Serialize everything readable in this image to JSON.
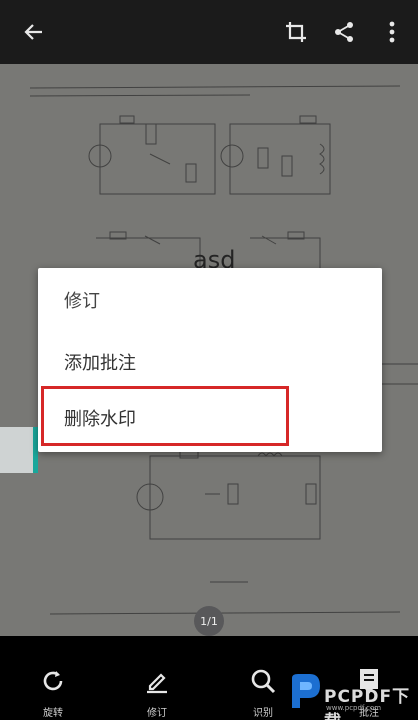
{
  "topbar": {
    "icons": [
      "back-arrow-icon",
      "crop-icon",
      "share-icon",
      "more-vertical-icon"
    ]
  },
  "document": {
    "watermark_text": "asd",
    "page_indicator": "1/1"
  },
  "menu": {
    "items": [
      {
        "label": "修订"
      },
      {
        "label": "添加批注"
      },
      {
        "label": "删除水印"
      }
    ],
    "highlight_color": "#d62828"
  },
  "bottombar": {
    "items": [
      {
        "label": "旋转",
        "icon": "rotate-icon"
      },
      {
        "label": "修订",
        "icon": "pen-icon"
      },
      {
        "label": "识别",
        "icon": "recognize-icon"
      },
      {
        "label": "批注",
        "icon": "note-icon"
      }
    ]
  },
  "site_watermark": {
    "text": "PCPDF下载",
    "sub": "www.pcpdf.com"
  },
  "colors": {
    "accent_teal": "#1aa79b",
    "highlight_red": "#d62828"
  }
}
